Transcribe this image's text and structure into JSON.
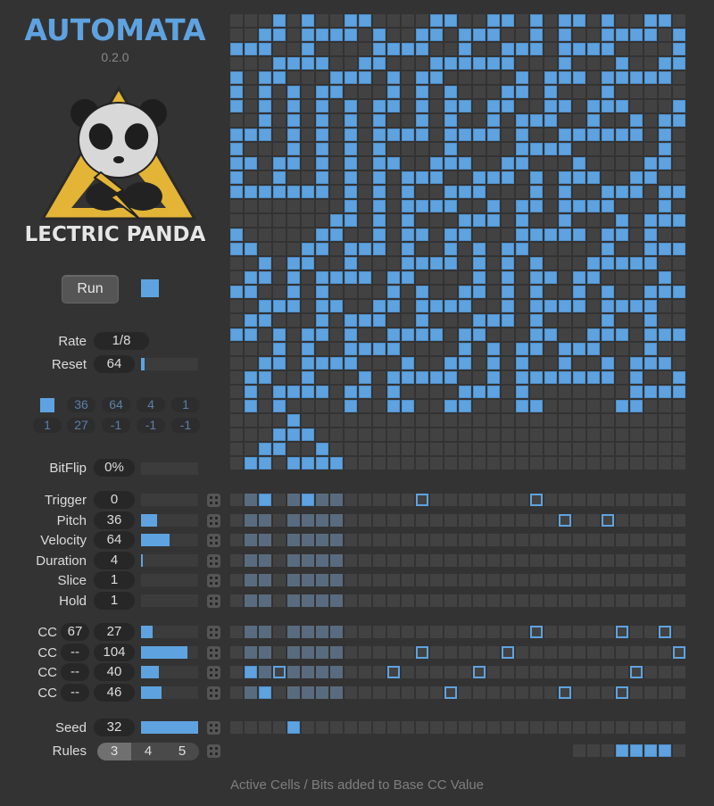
{
  "app": {
    "title": "AUTOMATA",
    "version": "0.2.0",
    "brand": "LECTRIC PANDA"
  },
  "colors": {
    "accent": "#5ea3e0",
    "background": "#333333",
    "cell_off": "#424242",
    "cell_active_column": "#596b7e",
    "logo_yellow": "#e3b436"
  },
  "transport": {
    "run_label": "Run",
    "running": true
  },
  "rate": {
    "label": "Rate",
    "value": "1/8"
  },
  "reset": {
    "label": "Reset",
    "value": "64",
    "fraction": 0.0625
  },
  "outputs_row1": {
    "indicator_on": true,
    "values": [
      "36",
      "64",
      "4",
      "1"
    ]
  },
  "outputs_row2": {
    "values": [
      "1",
      "27",
      "-1",
      "-1",
      "-1"
    ]
  },
  "bitflip": {
    "label": "BitFlip",
    "value": "0%",
    "fraction": 0
  },
  "params": [
    {
      "label": "Trigger",
      "value": "0",
      "fraction": 0
    },
    {
      "label": "Pitch",
      "value": "36",
      "fraction": 0.28
    },
    {
      "label": "Velocity",
      "value": "64",
      "fraction": 0.5
    },
    {
      "label": "Duration",
      "value": "4",
      "fraction": 0.03
    },
    {
      "label": "Slice",
      "value": "1",
      "fraction": 0
    },
    {
      "label": "Hold",
      "value": "1",
      "fraction": 0
    }
  ],
  "cc": [
    {
      "label": "CC",
      "number": "67",
      "value": "27",
      "fraction": 0.21
    },
    {
      "label": "CC",
      "number": "--",
      "value": "104",
      "fraction": 0.81
    },
    {
      "label": "CC",
      "number": "--",
      "value": "40",
      "fraction": 0.31
    },
    {
      "label": "CC",
      "number": "--",
      "value": "46",
      "fraction": 0.36
    }
  ],
  "seed": {
    "label": "Seed",
    "value": "32",
    "fraction": 1.0
  },
  "rules": {
    "label": "Rules",
    "options": [
      "3",
      "4",
      "5"
    ],
    "selected": "3"
  },
  "footer": "Active Cells / Bits added to Base CC Value",
  "grid": [
    "00010100110000110011010110100110",
    "00110111101001101110010100111101",
    "11100100001111001001110111100001",
    "00011110011000111111000100010011",
    "10110001110101100000101110111110",
    "10101011000101010001101000100000",
    "10101010101101011011001101110001",
    "00101010101001010010111001001011",
    "11101010101111011110100111111010",
    "10001010101000010000111100000010",
    "11011010101100111001100010000110",
    "10010010101011100111010111001100",
    "11111110101010011100010100111011",
    "00000000101011110010110111100010",
    "00000001101010001110100100010111",
    "10000011001011011000111110110100",
    "11000110111010010101100000100111",
    "00101100100011110101010001111100",
    "01101011110110000101011011000010",
    "11001010000101001101010010100111",
    "00111011001101111001011110111100",
    "01100010111001000111010000100100",
    "11010110100111101100011001110111",
    "00010100111100001010110111000100",
    "00110111100010011010100100101110",
    "01100100010111110010111111101001",
    "01011110110100001110100000001111",
    "01010000100110011000110000011000",
    "00001000000000000000000000000000",
    "00011100000000000000000000000000",
    "00110010000000000000000000000000",
    "01101111000000000000000000000000"
  ],
  "lanes": {
    "trigger": {
      "filled": [
        2,
        5
      ],
      "outlined": [
        13,
        21
      ]
    },
    "pitch": {
      "filled": [],
      "outlined": [
        23,
        26
      ]
    },
    "velocity": {
      "filled": [],
      "outlined": []
    },
    "duration": {
      "filled": [],
      "outlined": []
    },
    "slice": {
      "filled": [],
      "outlined": []
    },
    "hold": {
      "filled": [],
      "outlined": []
    },
    "cc1": {
      "filled": [],
      "outlined": [
        21,
        27,
        30
      ]
    },
    "cc2": {
      "filled": [],
      "outlined": [
        13,
        19,
        31
      ]
    },
    "cc3": {
      "filled": [
        1
      ],
      "outlined": [
        3,
        11,
        17,
        28
      ]
    },
    "cc4": {
      "filled": [
        2
      ],
      "outlined": [
        15,
        23,
        27
      ]
    },
    "seed": {
      "filled": [
        4
      ],
      "outlined": []
    },
    "rules": {
      "start": 24,
      "bits": "00011110"
    }
  }
}
